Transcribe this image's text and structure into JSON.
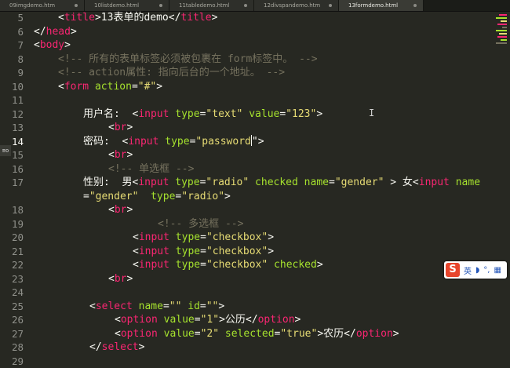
{
  "tabs": [
    {
      "label": "09imgdemo.htm"
    },
    {
      "label": "10listdemo.html"
    },
    {
      "label": "11tabledemo.html"
    },
    {
      "label": "12divspandemo.htm"
    },
    {
      "label": "13formdemo.html"
    }
  ],
  "gutter": {
    "fold_marker": "≡o"
  },
  "lines": [
    {
      "n": "5"
    },
    {
      "n": "6"
    },
    {
      "n": "7"
    },
    {
      "n": "8"
    },
    {
      "n": "9"
    },
    {
      "n": "10"
    },
    {
      "n": "11"
    },
    {
      "n": "12"
    },
    {
      "n": "13"
    },
    {
      "n": "14"
    },
    {
      "n": "15"
    },
    {
      "n": "16"
    },
    {
      "n": "17"
    },
    {
      "n": "18"
    },
    {
      "n": "19"
    },
    {
      "n": "20"
    },
    {
      "n": "21"
    },
    {
      "n": "22"
    },
    {
      "n": "23"
    },
    {
      "n": "24"
    },
    {
      "n": "25"
    },
    {
      "n": "26"
    },
    {
      "n": "27"
    },
    {
      "n": "28"
    },
    {
      "n": "29"
    }
  ],
  "code": {
    "l5": [
      "<",
      "title",
      ">13表单的demo</",
      "title",
      ">"
    ],
    "l6": [
      "</",
      "head",
      ">"
    ],
    "l7": [
      "<",
      "body",
      ">"
    ],
    "l8": "<!-- 所有的表单标签必须被包裹在 form标签中。 -->",
    "l9": "<!-- action属性: 指向后台的一个地址。 -->",
    "l10": [
      "<",
      "form",
      " ",
      "action",
      "=",
      "\"#\"",
      ">"
    ],
    "l12": [
      "用户名:  <",
      "input",
      " ",
      "type",
      "=",
      "\"text\"",
      " ",
      "value",
      "=",
      "\"123\"",
      ">"
    ],
    "l13": [
      "<",
      "br",
      ">"
    ],
    "l14": [
      "密码:  <",
      "input",
      " ",
      "type",
      "=",
      "\"password",
      "\">"
    ],
    "l15": [
      "<",
      "br",
      ">"
    ],
    "l16": "<!-- 单选框 -->",
    "l17": [
      "性别:  男<",
      "input",
      " ",
      "type",
      "=",
      "\"radio\"",
      " ",
      "checked",
      " ",
      "name",
      "=",
      "\"gender\"",
      " > 女<",
      "input",
      " ",
      "name"
    ],
    "l17b": [
      "=",
      "\"gender\"",
      "  ",
      "type",
      "=",
      "\"radio\"",
      ">"
    ],
    "l18": [
      "<",
      "br",
      ">"
    ],
    "l19": "<!-- 多选框 -->",
    "l20": [
      "<",
      "input",
      " ",
      "type",
      "=",
      "\"checkbox\"",
      ">"
    ],
    "l21": [
      "<",
      "input",
      " ",
      "type",
      "=",
      "\"checkbox\"",
      ">"
    ],
    "l22": [
      "<",
      "input",
      " ",
      "type",
      "=",
      "\"checkbox\"",
      " ",
      "checked",
      ">"
    ],
    "l23": [
      "<",
      "br",
      ">"
    ],
    "l25": [
      "<",
      "select",
      " ",
      "name",
      "=",
      "\"\"",
      " ",
      "id",
      "=",
      "\"\"",
      ">"
    ],
    "l26": [
      "<",
      "option",
      " ",
      "value",
      "=",
      "\"1\"",
      ">公历</",
      "option",
      ">"
    ],
    "l27": [
      "<",
      "option",
      " ",
      "value",
      "=",
      "\"2\"",
      " ",
      "selected",
      "=",
      "\"true\"",
      ">农历</",
      "option",
      ">"
    ],
    "l28": [
      "</",
      "select",
      ">"
    ]
  },
  "ime": {
    "logo": "S",
    "mode": "英"
  },
  "colors": {
    "tag": "#f92672",
    "attr": "#a6e22e",
    "string": "#e6db74",
    "comment": "#75715e",
    "text": "#f8f8f2",
    "bg": "#272822"
  }
}
